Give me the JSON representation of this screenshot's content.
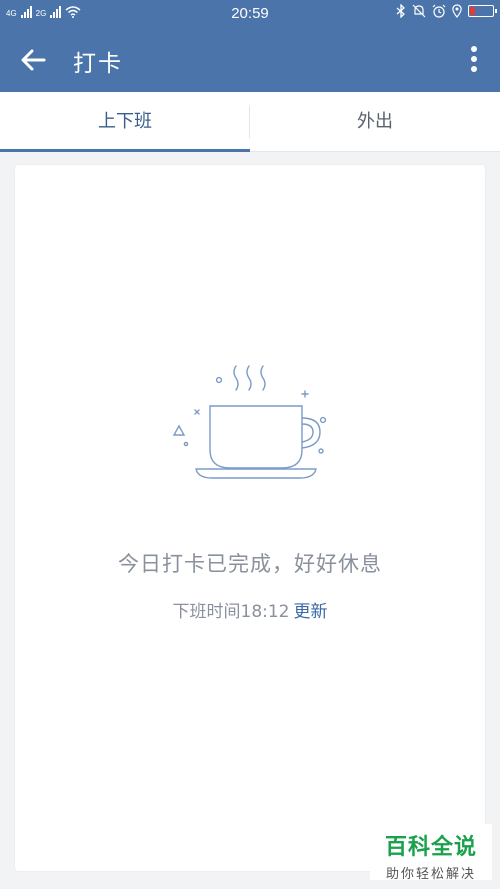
{
  "status_bar": {
    "network_1": "4G",
    "network_2": "2G",
    "time": "20:59"
  },
  "app_bar": {
    "title": "打卡"
  },
  "tabs": [
    {
      "label": "上下班",
      "active": true
    },
    {
      "label": "外出",
      "active": false
    }
  ],
  "card": {
    "message": "今日打卡已完成，好好休息",
    "clock_out_text": "下班时间18:12",
    "update_link": "更新"
  },
  "watermark": {
    "main": "百科全说",
    "sub": "助你轻松解决"
  },
  "colors": {
    "primary": "#4a74aa",
    "link": "#3a68a8",
    "muted_text": "#8a919c",
    "watermark_green": "#1aa14b",
    "battery_low": "#e53935"
  },
  "icons": {
    "back": "arrow-left-icon",
    "more": "more-vert-icon",
    "illustration": "coffee-cup-icon"
  }
}
